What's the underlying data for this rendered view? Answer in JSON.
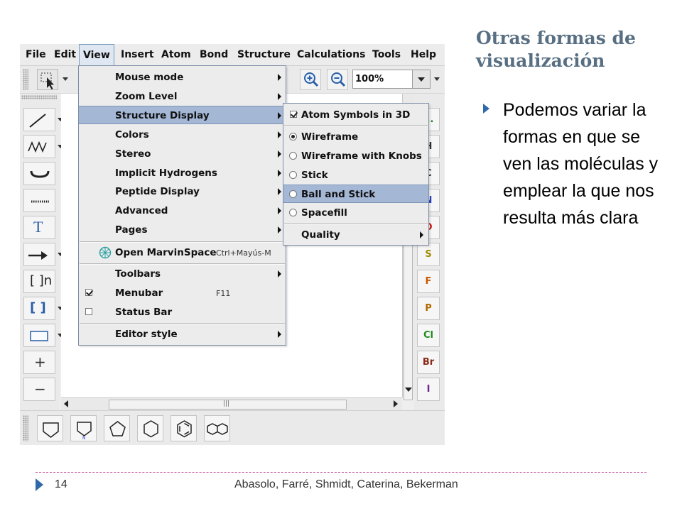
{
  "slide": {
    "title_line1": "Otras formas de",
    "title_line2": "visualización",
    "bullet_text": "Podemos variar la formas en que se ven las moléculas y emplear la que nos resulta más clara",
    "footer_page": "14",
    "footer_authors": "Abasolo, Farré, Shmidt, Caterina, Bekerman"
  },
  "app": {
    "menubar": [
      "File",
      "Edit",
      "View",
      "Insert",
      "Atom",
      "Bond",
      "Structure",
      "Calculations",
      "Tools",
      "Help"
    ],
    "active_menu": "View",
    "zoom_value": "100%",
    "view_menu": {
      "items": [
        {
          "label": "Mouse mode",
          "submenu": true
        },
        {
          "label": "Zoom Level",
          "submenu": true
        },
        {
          "label": "Structure Display",
          "submenu": true,
          "highlighted": true
        },
        {
          "label": "Colors",
          "submenu": true
        },
        {
          "label": "Stereo",
          "submenu": true
        },
        {
          "label": "Implicit Hydrogens",
          "submenu": true
        },
        {
          "label": "Peptide Display",
          "submenu": true
        },
        {
          "label": "Advanced",
          "submenu": true
        },
        {
          "label": "Pages",
          "submenu": true
        }
      ],
      "marvinspace": {
        "label": "Open MarvinSpace",
        "shortcut": "Ctrl+Mayús-M"
      },
      "toolbars": {
        "label": "Toolbars",
        "submenu": true
      },
      "menubar": {
        "label": "Menubar",
        "shortcut": "F11",
        "checked": true
      },
      "statusbar": {
        "label": "Status Bar",
        "checked": false
      },
      "editor_style": {
        "label": "Editor style",
        "submenu": true
      }
    },
    "structure_display_menu": {
      "atom_symbols": {
        "label": "Atom Symbols in 3D",
        "checked": true
      },
      "styles": [
        {
          "label": "Wireframe",
          "selected": true
        },
        {
          "label": "Wireframe with Knobs",
          "selected": false
        },
        {
          "label": "Stick",
          "selected": false
        },
        {
          "label": "Ball and Stick",
          "selected": false,
          "highlighted": true
        },
        {
          "label": "Spacefill",
          "selected": false
        }
      ],
      "quality": {
        "label": "Quality",
        "submenu": true
      }
    },
    "left_tools": [
      "line-tool",
      "chain-tool",
      "bracket-curve-tool",
      "dashed-bond-tool",
      "text-tool",
      "arrow-tool",
      "sgroup-bracket-tool",
      "bracket-tool",
      "rectangle-tool",
      "zoom-in",
      "zoom-out"
    ],
    "left_tool_text": {
      "text": "T",
      "bracket_n": "[ ]n",
      "brackets": "[ ]",
      "plus": "+",
      "minus": "−"
    },
    "element_buttons": [
      {
        "label": "...",
        "color": "#2a7d2a"
      },
      {
        "label": "H",
        "color": "#333333"
      },
      {
        "label": "C",
        "color": "#333333"
      },
      {
        "label": "N",
        "color": "#2b3fc4"
      },
      {
        "label": "O",
        "color": "#d11a1a"
      },
      {
        "label": "S",
        "color": "#a08a00"
      },
      {
        "label": "F",
        "color": "#c85a00"
      },
      {
        "label": "P",
        "color": "#b06a00"
      },
      {
        "label": "Cl",
        "color": "#1f8a1f"
      },
      {
        "label": "Br",
        "color": "#8a2a1a"
      },
      {
        "label": "I",
        "color": "#6a2a8a"
      }
    ],
    "ring_templates": [
      "pentagon-pyrrole",
      "pyrrole-n",
      "pentagon",
      "hexagon",
      "benzene",
      "naphthalene"
    ],
    "hscroll_grip": "|||"
  }
}
